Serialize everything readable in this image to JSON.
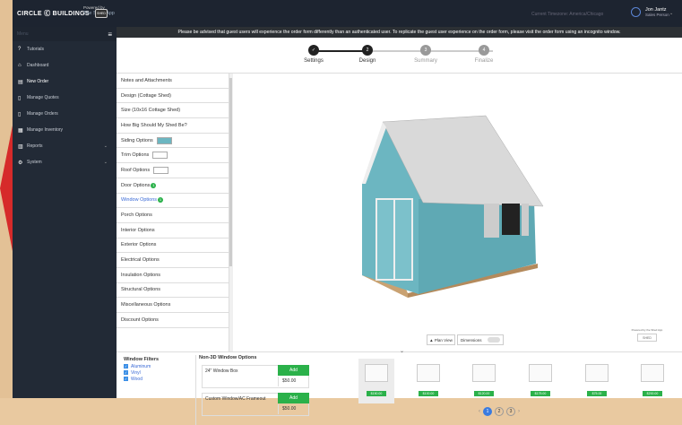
{
  "brand": {
    "logo_text": "CIRCLE Ⓒ BUILDINGS",
    "powered_by": "Powered by",
    "app_name": "The Shed App",
    "shed_logo": "SHED"
  },
  "header": {
    "timezone": "Current Timezone: America/Chicago",
    "user_name": "Jon Jantz",
    "user_role": "Sales Person"
  },
  "sidebar": {
    "menu_label": "Menu",
    "items": [
      {
        "label": "Tutorials",
        "icon": "?"
      },
      {
        "label": "Dashboard",
        "icon": "⌂"
      },
      {
        "label": "New Order",
        "icon": "▤"
      },
      {
        "label": "Manage Quotes",
        "icon": "▯"
      },
      {
        "label": "Manage Orders",
        "icon": "▯"
      },
      {
        "label": "Manage Inventory",
        "icon": "▦"
      },
      {
        "label": "Reports",
        "icon": "▥"
      },
      {
        "label": "System",
        "icon": "⚙"
      }
    ]
  },
  "notice": "Please be advised that guest users will experience the order form differently than an authenticated user. To replicate the guest user experience on the order form, please visit the order form using an incognito window.",
  "steps": [
    {
      "num": "✓",
      "label": "Settings"
    },
    {
      "num": "2",
      "label": "Design"
    },
    {
      "num": "3",
      "label": "Summary"
    },
    {
      "num": "4",
      "label": "Finalize"
    }
  ],
  "options": [
    "Notes and Attachments",
    "Design (Cottage Shed)",
    "Size (10x16 Cottage Shed)",
    "How Big Should My Shed Be?",
    "Siding Options",
    "Trim Options",
    "Roof Options",
    "Door Options",
    "Window Options",
    "Porch Options",
    "Interior Options",
    "Exterior Options",
    "Electrical Options",
    "Insulation Options",
    "Structural Options",
    "Miscellaneous Options",
    "Discount Options"
  ],
  "option_badges": {
    "door": "1",
    "window": "1"
  },
  "viewer": {
    "plan_view": "Plan View",
    "dimensions": "Dimensions",
    "powered_small": "Powered by the Shed App",
    "shed_logo": "SHED"
  },
  "colors": {
    "siding": "#6cb6c1",
    "accent": "#2bb14a",
    "link": "#3a6ad6"
  },
  "filters": {
    "title": "Window Filters",
    "items": [
      "Aluminum",
      "Vinyl",
      "Wood"
    ]
  },
  "windows": {
    "title": "Non-3D Window Options",
    "rows": [
      {
        "name": "24\" Window Box",
        "add": "Add",
        "price": "$50.00"
      },
      {
        "name": "Custom Window/AC Frameout",
        "add": "Add",
        "price": "$50.00"
      }
    ]
  },
  "thumbs": {
    "prices": [
      "$150.00",
      "$100.00",
      "$120.00",
      "$175.00",
      "$75.00",
      "$200.00"
    ]
  },
  "pager": {
    "pages": [
      "1",
      "2",
      "3"
    ]
  }
}
